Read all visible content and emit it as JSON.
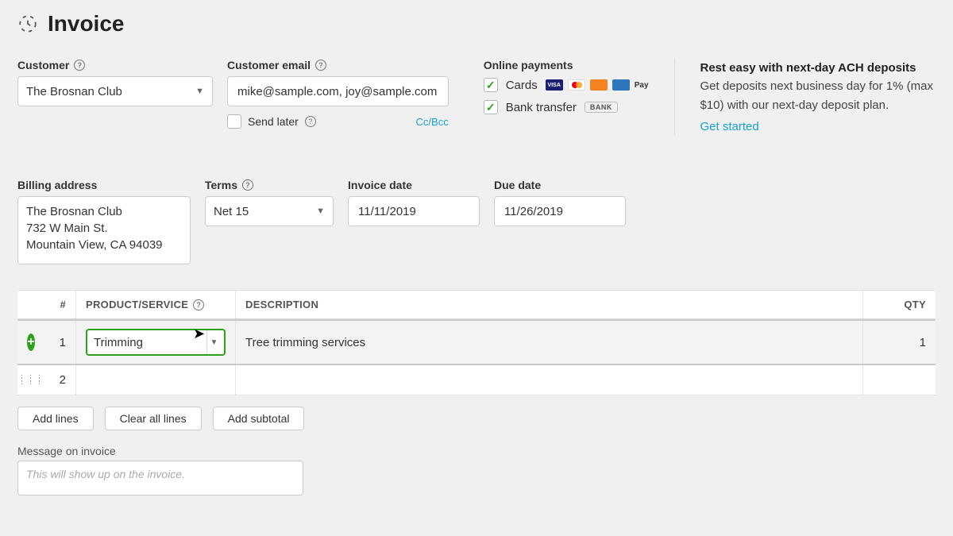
{
  "header": {
    "title": "Invoice"
  },
  "customer": {
    "label": "Customer",
    "value": "The Brosnan Club"
  },
  "email": {
    "label": "Customer email",
    "value": "mike@sample.com, joy@sample.com",
    "send_later_label": "Send later",
    "ccbcc": "Cc/Bcc"
  },
  "online_payments": {
    "title": "Online payments",
    "cards_label": "Cards",
    "bank_label": "Bank transfer",
    "bank_badge": "BANK",
    "apple_pay": "Pay"
  },
  "promo": {
    "title": "Rest easy with next-day ACH deposits",
    "body": "Get deposits next business day for 1% (max $10) with our next-day deposit plan.",
    "link": "Get started"
  },
  "billing": {
    "label": "Billing address",
    "address": "The Brosnan Club\n732 W Main St.\nMountain View, CA 94039"
  },
  "terms": {
    "label": "Terms",
    "value": "Net 15"
  },
  "invoice_date": {
    "label": "Invoice date",
    "value": "11/11/2019"
  },
  "due_date": {
    "label": "Due date",
    "value": "11/26/2019"
  },
  "table": {
    "headers": {
      "num": "#",
      "product": "PRODUCT/SERVICE",
      "description": "DESCRIPTION",
      "qty": "QTY"
    },
    "rows": [
      {
        "num": "1",
        "product": "Trimming",
        "description": "Tree trimming services",
        "qty": "1"
      },
      {
        "num": "2",
        "product": "",
        "description": "",
        "qty": ""
      }
    ]
  },
  "buttons": {
    "add_lines": "Add lines",
    "clear_all": "Clear all lines",
    "add_subtotal": "Add subtotal"
  },
  "message": {
    "label": "Message on invoice",
    "placeholder": "This will show up on the invoice."
  }
}
